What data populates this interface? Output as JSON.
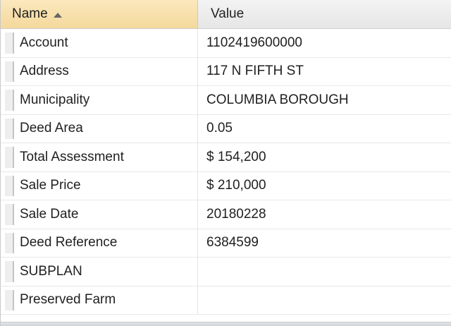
{
  "header": {
    "name_label": "Name",
    "value_label": "Value"
  },
  "rows": [
    {
      "name": "Account",
      "value": "1102419600000"
    },
    {
      "name": "Address",
      "value": "117 N FIFTH ST"
    },
    {
      "name": "Municipality",
      "value": "COLUMBIA BOROUGH"
    },
    {
      "name": "Deed Area",
      "value": "0.05"
    },
    {
      "name": "Total Assessment",
      "value": "$ 154,200"
    },
    {
      "name": "Sale Price",
      "value": "$ 210,000"
    },
    {
      "name": "Sale Date",
      "value": "20180228"
    },
    {
      "name": "Deed Reference",
      "value": "6384599"
    },
    {
      "name": "SUBPLAN",
      "value": ""
    },
    {
      "name": "Preserved Farm",
      "value": ""
    }
  ],
  "icons": {
    "sort": "sort-ascending-icon"
  }
}
